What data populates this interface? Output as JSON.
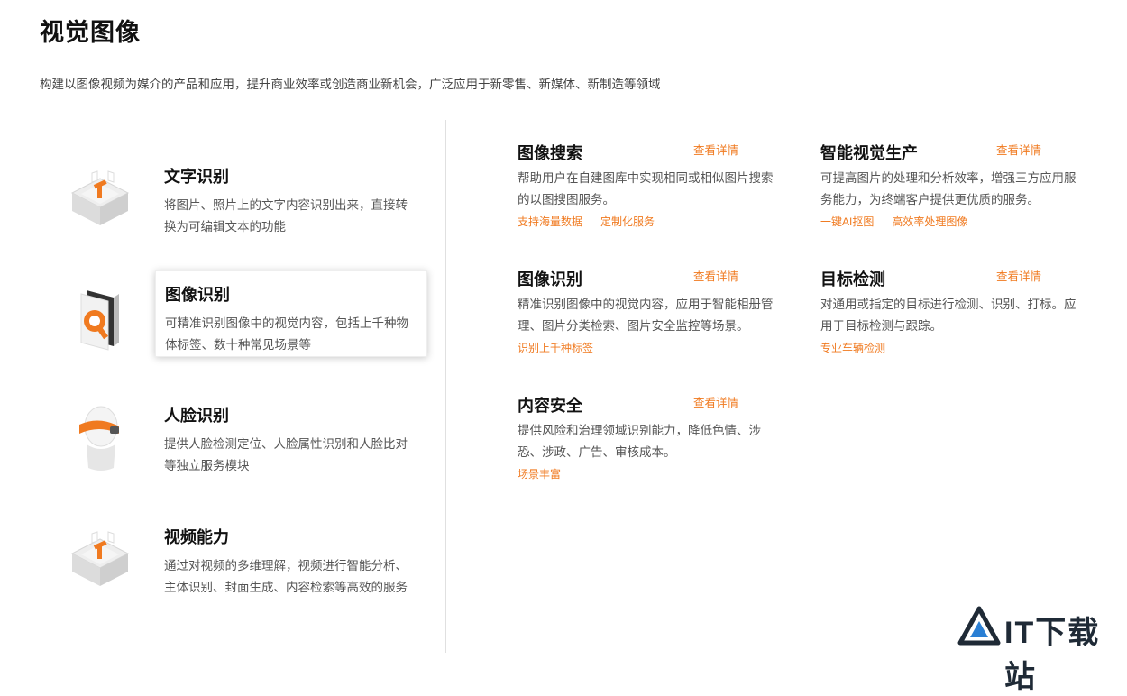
{
  "page": {
    "title": "视觉图像",
    "description": "构建以图像视频为媒介的产品和应用，提升商业效率或创造商业新机会，广泛应用于新零售、新媒体、新制造等领域"
  },
  "categories": [
    {
      "title": "文字识别",
      "desc": "将图片、照片上的文字内容识别出来，直接转换为可编辑文本的功能",
      "icon": "text-recognition-icon"
    },
    {
      "title": "图像识别",
      "desc": "可精准识别图像中的视觉内容，包括上千种物体标签、数十种常见场景等",
      "icon": "image-recognition-icon"
    },
    {
      "title": "人脸识别",
      "desc": "提供人脸检测定位、人脸属性识别和人脸比对等独立服务模块",
      "icon": "face-recognition-icon"
    },
    {
      "title": "视频能力",
      "desc": "通过对视频的多维理解，视频进行智能分析、主体识别、封面生成、内容检索等高效的服务",
      "icon": "video-ability-icon"
    }
  ],
  "cards": [
    {
      "title": "图像搜索",
      "more": "查看详情",
      "desc": "帮助用户在自建图库中实现相同或相似图片搜索的以图搜图服务。",
      "tags": [
        "支持海量数据",
        "定制化服务"
      ]
    },
    {
      "title": "智能视觉生产",
      "more": "查看详情",
      "desc": "可提高图片的处理和分析效率，增强三方应用服务能力，为终端客户提供更优质的服务。",
      "tags": [
        "一键AI抠图",
        "高效率处理图像"
      ]
    },
    {
      "title": "图像识别",
      "more": "查看详情",
      "desc": "精准识别图像中的视觉内容，应用于智能相册管理、图片分类检索、图片安全监控等场景。",
      "tags": [
        "识别上千种标签"
      ]
    },
    {
      "title": "目标检测",
      "more": "查看详情",
      "desc": "对通用或指定的目标进行检测、识别、打标。应用于目标检测与跟踪。",
      "tags": [
        "专业车辆检测"
      ]
    },
    {
      "title": "内容安全",
      "more": "查看详情",
      "desc": "提供风险和治理领域识别能力，降低色情、涉恐、涉政、广告、审核成本。",
      "tags": [
        "场景丰富"
      ]
    }
  ],
  "watermark": {
    "text": "IT下载站"
  },
  "colors": {
    "accent": "#f07a20",
    "text": "#111111",
    "muted": "#555555"
  }
}
